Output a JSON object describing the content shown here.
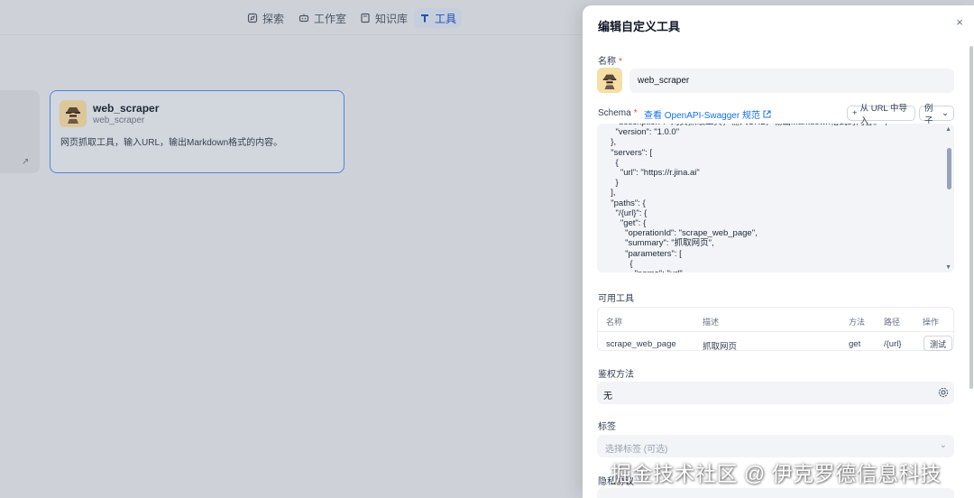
{
  "nav": {
    "items": [
      {
        "label": "探索",
        "icon": "compass-icon"
      },
      {
        "label": "工作室",
        "icon": "robot-icon"
      },
      {
        "label": "知识库",
        "icon": "book-icon"
      },
      {
        "label": "工具",
        "icon": "tool-icon",
        "active": true
      }
    ]
  },
  "tool_card": {
    "name": "web_scraper",
    "sub": "web_scraper",
    "description": "网页抓取工具，输入URL，输出Markdown格式的内容。"
  },
  "drawer": {
    "title": "编辑自定义工具",
    "close": "×",
    "name_label": "名称",
    "required_mark": "*",
    "name_value": "web_scraper",
    "schema_label": "Schema",
    "schema_link": "查看 OpenAPI-Swagger 规范",
    "import_button": "从 URL 中导入",
    "example_button": "例子",
    "schema_code": [
      "    \"description\": \"网页抓取工具，输入URL，输出Markdown格式的内容。\",",
      "    \"version\": \"1.0.0\"",
      "  },",
      "  \"servers\": [",
      "    {",
      "      \"url\": \"https://r.jina.ai\"",
      "    }",
      "  ],",
      "  \"paths\": {",
      "    \"/{url}\": {",
      "      \"get\": {",
      "        \"operationId\": \"scrape_web_page\",",
      "        \"summary\": \"抓取网页\",",
      "        \"parameters\": [",
      "          {",
      "            \"name\": \"url\","
    ],
    "tools_label": "可用工具",
    "table": {
      "headers": [
        "名称",
        "描述",
        "方法",
        "路径",
        "操作"
      ],
      "rows": [
        {
          "name": "scrape_web_page",
          "desc": "抓取网页",
          "method": "get",
          "path": "/{url}",
          "action": "测试"
        }
      ]
    },
    "auth_label": "鉴权方法",
    "auth_value": "无",
    "tags_label": "标签",
    "tags_placeholder": "选择标签 (可选)",
    "privacy_label": "隐私协议"
  },
  "watermark": "掘金技术社区 @ 伊克罗德信息科技"
}
